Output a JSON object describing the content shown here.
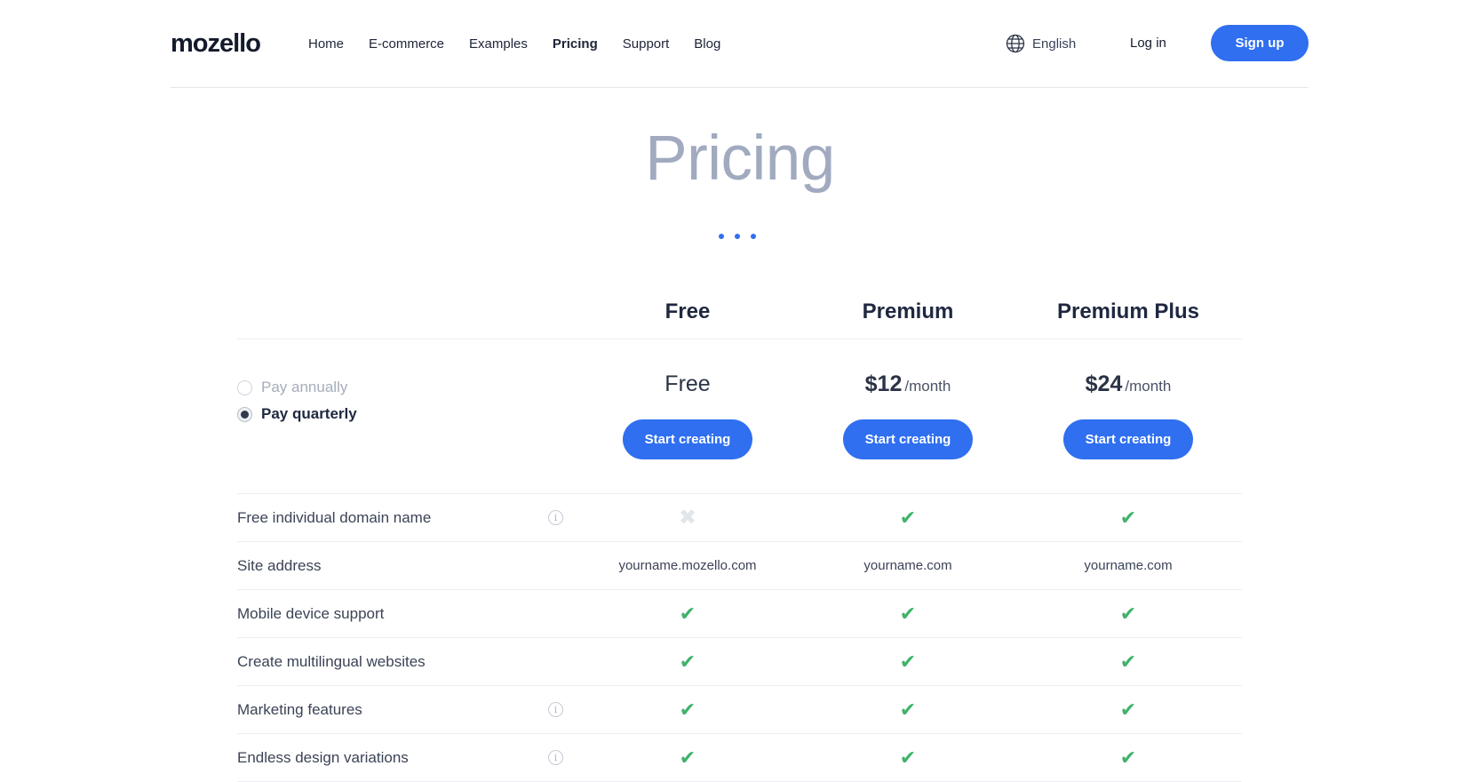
{
  "header": {
    "logo": "mozello",
    "nav": [
      {
        "label": "Home",
        "active": false
      },
      {
        "label": "E-commerce",
        "active": false
      },
      {
        "label": "Examples",
        "active": false
      },
      {
        "label": "Pricing",
        "active": true
      },
      {
        "label": "Support",
        "active": false
      },
      {
        "label": "Blog",
        "active": false
      }
    ],
    "language": "English",
    "login": "Log in",
    "signup": "Sign up"
  },
  "title": "Pricing",
  "plans": [
    {
      "name": "Free",
      "price": "Free",
      "period": "",
      "cta": "Start creating"
    },
    {
      "name": "Premium",
      "price": "$12",
      "period": "/month",
      "cta": "Start creating"
    },
    {
      "name": "Premium Plus",
      "price": "$24",
      "period": "/month",
      "cta": "Start creating"
    }
  ],
  "billing": {
    "options": [
      "Pay annually",
      "Pay quarterly"
    ],
    "selected": "Pay quarterly"
  },
  "features": [
    {
      "label": "Free individual domain name",
      "info": true,
      "values": [
        "cross",
        "check",
        "check"
      ]
    },
    {
      "label": "Site address",
      "info": false,
      "values": [
        "yourname.mozello.com",
        "yourname.com",
        "yourname.com"
      ]
    },
    {
      "label": "Mobile device support",
      "info": false,
      "values": [
        "check",
        "check",
        "check"
      ]
    },
    {
      "label": "Create multilingual websites",
      "info": false,
      "values": [
        "check",
        "check",
        "check"
      ]
    },
    {
      "label": "Marketing features",
      "info": true,
      "values": [
        "check",
        "check",
        "check"
      ]
    },
    {
      "label": "Endless design variations",
      "info": true,
      "values": [
        "check",
        "check",
        "check"
      ]
    }
  ],
  "colors": {
    "accent": "#2f6ff0",
    "check": "#3fb36a",
    "cross": "#e2e5ea",
    "title": "#a1aabf"
  }
}
